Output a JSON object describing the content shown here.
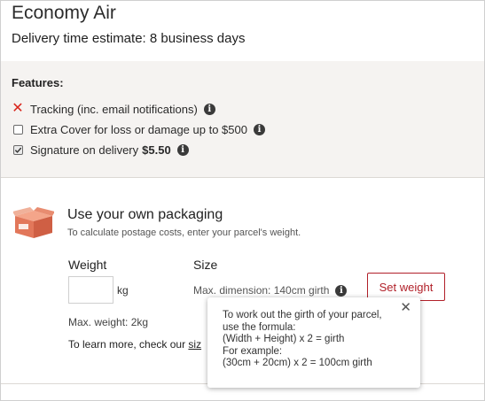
{
  "header": {
    "title": "Economy Air",
    "subtitle": "Delivery time estimate: 8 business days"
  },
  "features": {
    "heading": "Features:",
    "items": [
      {
        "label": "Tracking (inc. email notifications)",
        "state": "not-included",
        "icon": "x-icon"
      },
      {
        "label": "Extra Cover for loss or damage up to $500",
        "state": "unchecked",
        "icon": "checkbox"
      },
      {
        "label": "Signature on delivery",
        "price": "$5.50",
        "state": "checked",
        "icon": "checkbox"
      }
    ]
  },
  "packaging": {
    "title": "Use your own packaging",
    "subtitle": "To calculate postage costs, enter your parcel's weight.",
    "weight_label": "Weight",
    "weight_value": "",
    "unit": "kg",
    "size_label": "Size",
    "max_dimension": "Max. dimension: 140cm girth",
    "set_weight_button": "Set weight",
    "max_weight": "Max. weight: 2kg",
    "learn_more_prefix": "To learn more, check our ",
    "learn_more_link": "siz"
  },
  "tooltip": {
    "lines": [
      "To work out the girth of your parcel,",
      "use the formula:",
      "(Width + Height) x 2 = girth",
      "For example:",
      "(30cm + 20cm) x 2 = 100cm girth"
    ],
    "close_symbol": "✕"
  },
  "colors": {
    "accent": "#b12029",
    "x_mark": "#d9251c",
    "features_bg": "#f5f3f1"
  }
}
